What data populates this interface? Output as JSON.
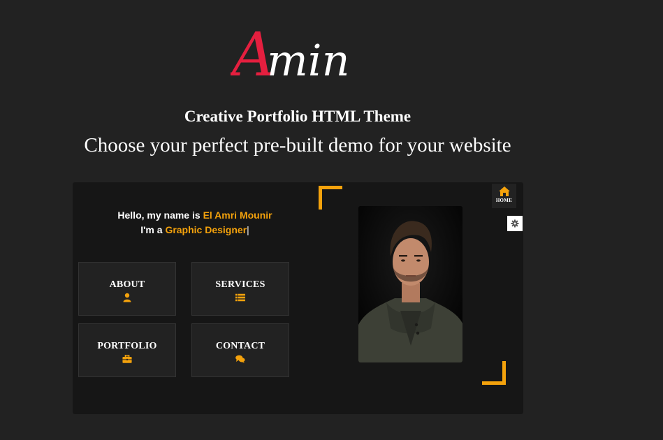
{
  "brand": {
    "logo_first_letter": "A",
    "logo_rest": "min",
    "accent_color": "#e51f3f"
  },
  "header": {
    "tagline": "Creative Portfolio HTML Theme",
    "subtitle": "Choose your perfect pre-built demo for your website"
  },
  "preview": {
    "intro": {
      "line1_prefix": "Hello, my name is ",
      "name": "El Amri Mounir",
      "line2_prefix": "I'm a ",
      "role": "Graphic Designer",
      "caret": "|"
    },
    "menu": [
      {
        "label": "ABOUT",
        "icon": "user-icon"
      },
      {
        "label": "SERVICES",
        "icon": "list-icon"
      },
      {
        "label": "PORTFOLIO",
        "icon": "briefcase-icon"
      },
      {
        "label": "CONTACT",
        "icon": "comments-icon"
      }
    ],
    "home_label": "HOME",
    "home_icon": "home-icon",
    "settings_icon": "gear-icon",
    "accent_color": "#f4a20c"
  }
}
